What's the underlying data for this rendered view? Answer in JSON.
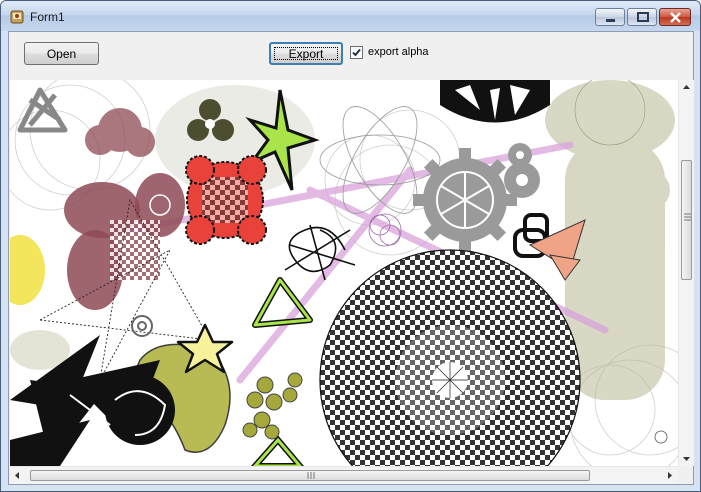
{
  "window": {
    "title": "Form1"
  },
  "icons": {
    "app": "app-icon",
    "minimize": "minimize-icon",
    "maximize": "maximize-icon",
    "close": "close-icon",
    "checkmark": "checkmark-icon"
  },
  "toolbar": {
    "open_label": "Open",
    "export_label": "Export",
    "export_alpha_label": "export alpha",
    "export_alpha_checked": true
  },
  "colors": {
    "accent_purple": "#d9a3dc",
    "lime": "#a8e44a",
    "maroon": "#8e4a55",
    "red": "#e8423a",
    "olive": "#b5b84a",
    "orange": "#f0a487"
  }
}
